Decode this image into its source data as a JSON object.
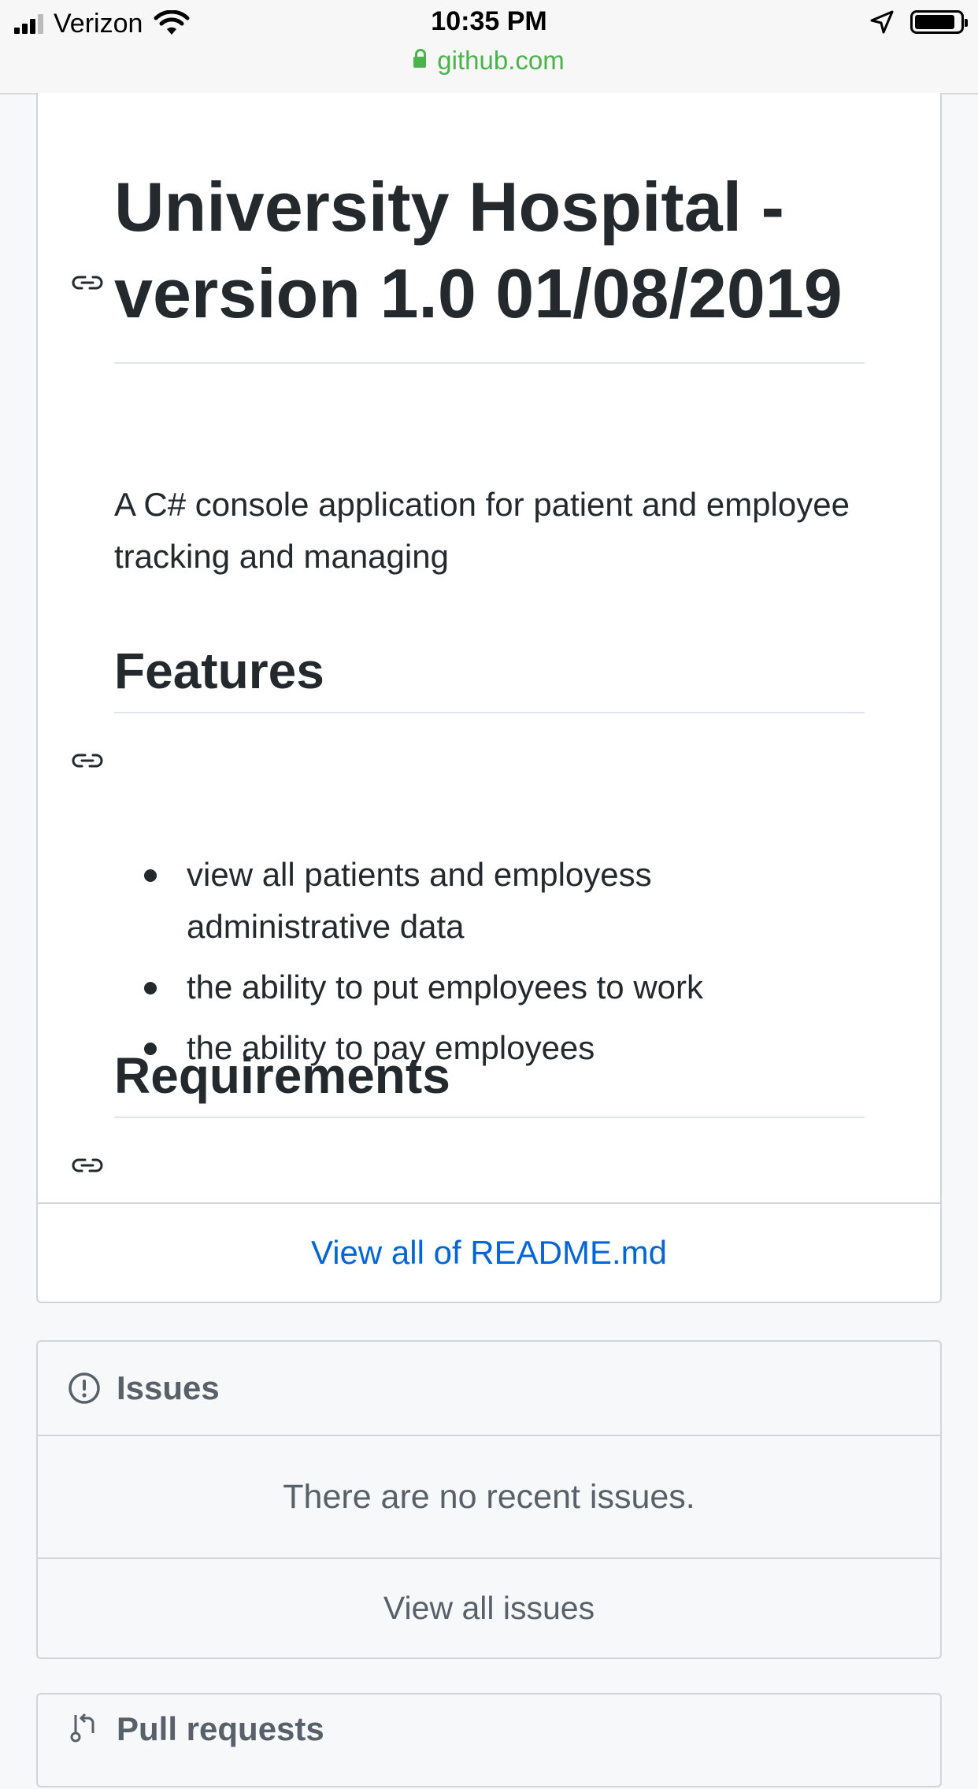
{
  "status_bar": {
    "carrier": "Verizon",
    "time": "10:35 PM",
    "url": "github.com",
    "battery_level": 0.9
  },
  "readme": {
    "title": "University Hospital - version 1.0 01/08/2019",
    "description": "A C# console application for patient and employee tracking and managing",
    "features_heading": "Features",
    "features": [
      "view all patients and employess administrative data",
      "the ability to put employees to work",
      "the ability to pay employees"
    ],
    "requirements_heading": "Requirements",
    "view_all_link": "View all of README.md"
  },
  "issues": {
    "title": "Issues",
    "empty_message": "There are no recent issues.",
    "view_all": "View all issues"
  },
  "pull_requests": {
    "title": "Pull requests"
  },
  "colors": {
    "link": "#0366d6",
    "secure_url": "#4cb24c",
    "muted": "#586069"
  }
}
